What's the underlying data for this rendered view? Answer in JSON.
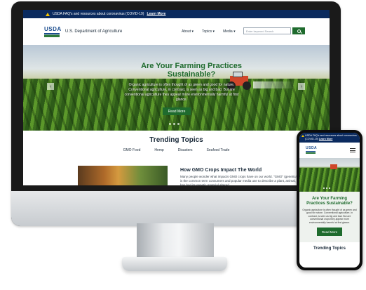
{
  "desktop": {
    "alert": {
      "text": "USDA FAQ's and resources about coronavirus (COVID-19)",
      "link": "Learn More"
    },
    "header": {
      "logo": "USDA",
      "agency": "U.S. Department of Agriculture",
      "nav": [
        "About",
        "Topics",
        "Media"
      ],
      "search_placeholder": "Enter keyword Search"
    },
    "hero": {
      "title": "Are Your Farming Practices Sustainable?",
      "description": "Organic agriculture is often thought of as green and good for nature. Conventional agriculture, in contrast, is seen as big and bad. But are conventional agriculture they appear more environmentally harmful at first glance.",
      "cta": "Read More"
    },
    "trending": {
      "title": "Trending Topics",
      "tabs": [
        "GMO Food",
        "Hemp",
        "Disasters",
        "Seafood Trade"
      ]
    },
    "article": {
      "title": "How GMO Crops Impact The World",
      "body": "Many people wonder what impacts GMO crops have on our world. \"GMO\" (genetically modified organism) is the common term consumers and popular media use to describe a plant, animal, or other organism that has had its genetic material altered."
    }
  },
  "phone": {
    "alert": {
      "text": "USDA FAQ's and resources about coronavirus (COVID-19)",
      "link": "Learn More"
    },
    "logo": "USDA",
    "hero": {
      "title": "Are Your Farming Practices Sustainable?",
      "description": "Organic agriculture is often thought of as green and good for nature. Conventional agriculture, in contrast, is seen as big and bad. But are conventional crops they appear more environmentally harmful at first glance.",
      "cta": "Read More"
    },
    "trending_title": "Trending Topics"
  },
  "colors": {
    "navy": "#0a2a5e",
    "green": "#1f6b2e",
    "usda_blue": "#1b4d8f"
  }
}
